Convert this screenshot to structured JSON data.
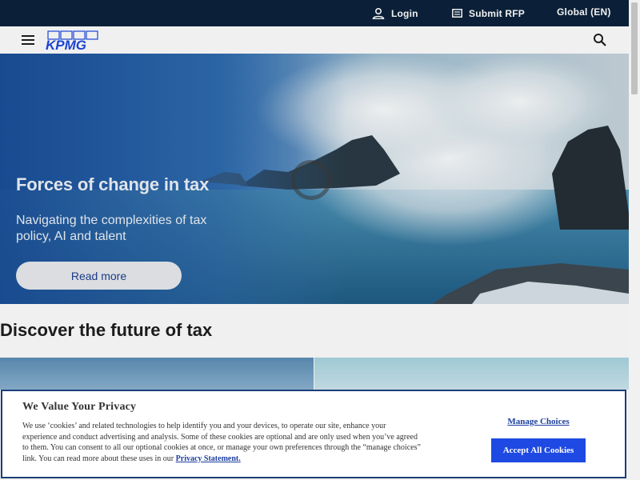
{
  "topbar": {
    "login_label": "Login",
    "rfp_label": "Submit RFP",
    "locale_label": "Global (EN)",
    "background": "#0c233c"
  },
  "navbar": {
    "logo_text": "KPMG",
    "menu_icon": "hamburger-icon",
    "search_icon": "search-icon"
  },
  "hero": {
    "title": "Forces of change in tax",
    "subtitle": "Navigating the complexities of tax policy, AI and talent",
    "cta_label": "Read more",
    "loading_icon": "loading-spinner-icon"
  },
  "section": {
    "title": "Discover the future of tax"
  },
  "cookie_banner": {
    "title": "We Value Your Privacy",
    "body": "We use ‘cookies’ and related technologies to help identify you and your devices, to operate our site, enhance your experience and conduct advertising and analysis. Some of these cookies are optional and are only used when you’ve agreed to them. You can consent to all our optional cookies at once, or manage your own preferences through the “manage choices” link. You can read more about these uses in our",
    "privacy_link": "Privacy Statement.",
    "manage_label": "Manage Choices",
    "accept_label": "Accept All Cookies",
    "accent": "#1e49e2"
  }
}
